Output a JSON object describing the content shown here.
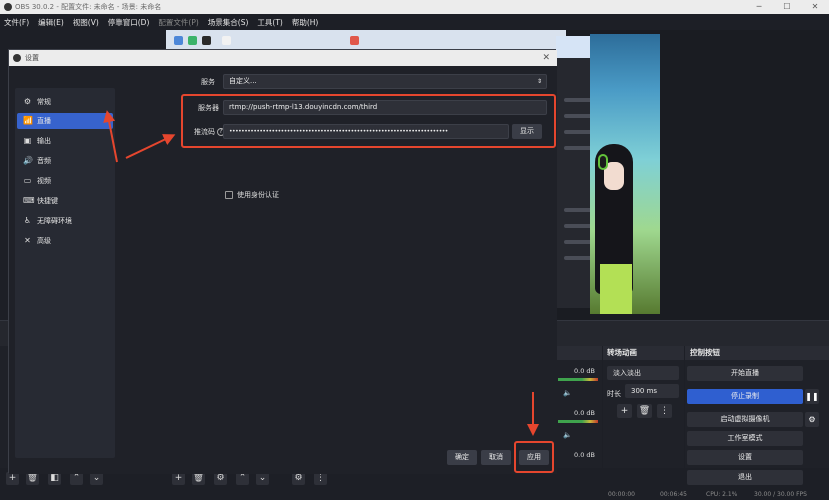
{
  "window": {
    "title": "OBS 30.0.2 - 配置文件: 未命名 - 场景: 未命名",
    "minimize": "─",
    "maximize": "☐",
    "close": "✕"
  },
  "menu": {
    "items": [
      "文件(F)",
      "编辑(E)",
      "视图(V)",
      "停靠窗口(D)",
      "配置文件(P)",
      "场景集合(S)",
      "工具(T)",
      "帮助(H)"
    ]
  },
  "dialog": {
    "title": "设置",
    "close": "✕",
    "nav": [
      {
        "label": "常规",
        "icon": "⚙"
      },
      {
        "label": "直播",
        "icon": "📶"
      },
      {
        "label": "输出",
        "icon": "▣"
      },
      {
        "label": "音频",
        "icon": "🔊"
      },
      {
        "label": "视频",
        "icon": "▭"
      },
      {
        "label": "快捷键",
        "icon": "⌨"
      },
      {
        "label": "无障碍环境",
        "icon": "♿"
      },
      {
        "label": "高级",
        "icon": "✕"
      }
    ],
    "service_label": "服务",
    "service_value": "自定义...",
    "server_label": "服务器",
    "server_value": "rtmp://push-rtmp-l13.douyincdn.com/third",
    "key_label": "推流码",
    "key_value": "••••••••••••••••••••••••••••••••••••••••••••••••••••••••••••••••••••••••",
    "show_label": "显示",
    "auth_label": "使用身份认证",
    "ok_label": "确定",
    "cancel_label": "取消",
    "apply_label": "应用"
  },
  "mixer": {
    "db1": "0.0 dB",
    "db2": "0.0 dB",
    "db3": "0.0 dB"
  },
  "transitions": {
    "title": "转场动画",
    "selected": "淡入淡出",
    "duration_label": "时长",
    "duration_value": "300 ms"
  },
  "controls": {
    "title": "控制按钮",
    "start_stream": "开始直播",
    "stop_record": "停止录制",
    "start_vcam": "启动虚拟摄像机",
    "studio_mode": "工作室模式",
    "settings": "设置",
    "exit": "退出"
  },
  "status": {
    "t1": "00:00:00",
    "t2": "00:06:45",
    "cpu": "CPU: 2.1%",
    "fps": "30.00 / 30.00 FPS"
  },
  "colors": {
    "accent": "#3763cd",
    "highlight": "#e5462e"
  }
}
